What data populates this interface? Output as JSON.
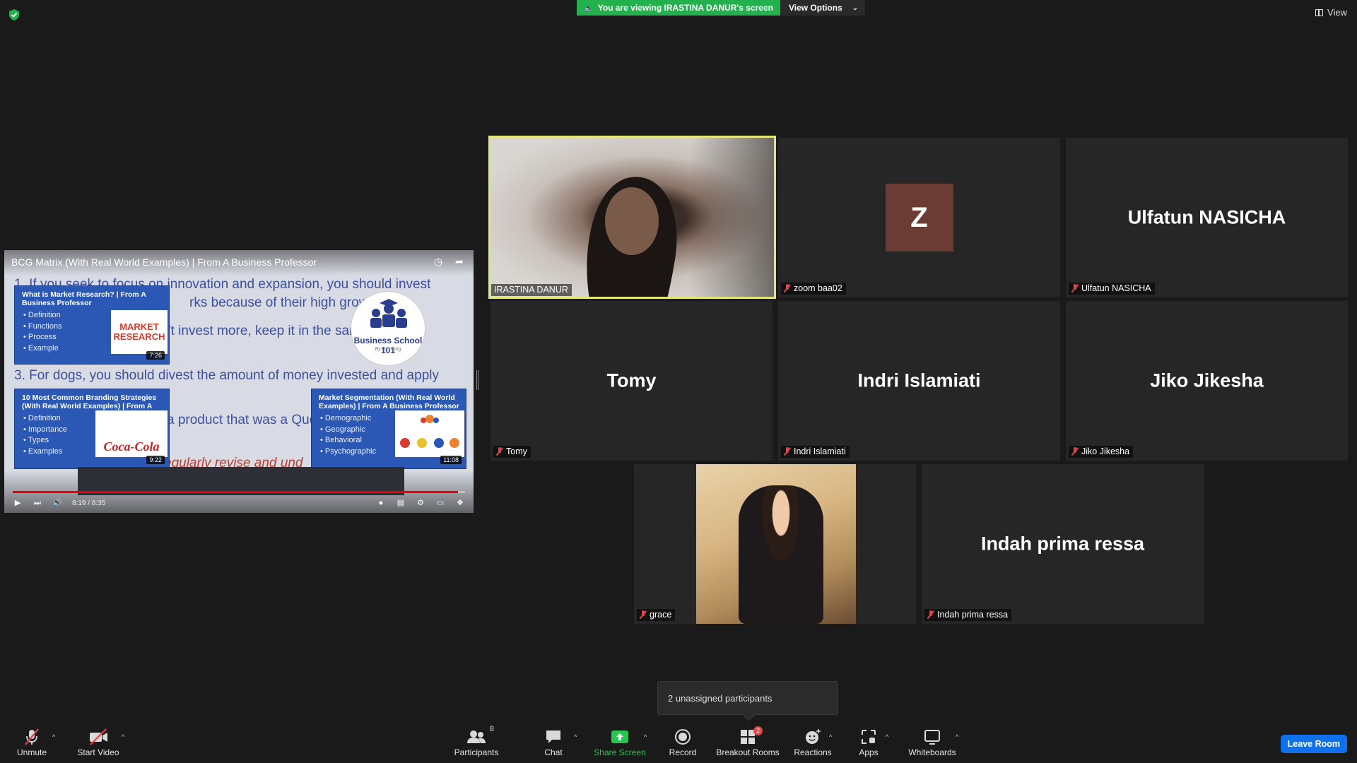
{
  "top_bar": {
    "viewing_text": "You are viewing IRASTINA DANUR's screen",
    "view_options_label": "View Options",
    "view_label": "View",
    "icons": [
      "security-shield-icon",
      "speaker-icon",
      "chevron-down-icon",
      "grid-icon"
    ]
  },
  "shared_screen": {
    "video_title": "BCG Matrix (With Real World Examples) | From A Business Professor",
    "slide_lines": [
      "1. If you seek to focus on innovation and expansion, you should invest",
      "rks because of their high growth",
      "'t invest more, keep it in the san",
      "3. For dogs, you should divest the amount of money invested and apply",
      "a product that was a Que",
      "egularly revise and und"
    ],
    "logo_text": "Business School 101",
    "logo_sub": "By Dr. Yong",
    "cards": [
      {
        "title": "What is Market Research? | From A Business Professor",
        "items": [
          "Definition",
          "Functions",
          "Process",
          "Example"
        ],
        "thumb_text": "MARKET RESEARCH",
        "duration": "7:26"
      },
      {
        "title": "10 Most Common Branding Strategies (With Real World Examples) | From A",
        "items": [
          "Definition",
          "Importance",
          "Types",
          "Examples"
        ],
        "thumb_text": "Coca-Cola",
        "duration": "9:22"
      },
      {
        "title": "Market Segmentation (With Real World Examples) | From A Business Professor",
        "items": [
          "Demographic",
          "Geographic",
          "Behavioral",
          "Psychographic"
        ],
        "duration": "11:08"
      }
    ],
    "time_display": "8:19 / 8:35",
    "progress": 0.984
  },
  "participants_tiles": [
    {
      "name": "IRASTINA DANUR",
      "label": "IRASTINA DANUR",
      "video": true,
      "active_speaker": true,
      "muted": false
    },
    {
      "name": "zoom baa02",
      "label": "zoom baa02",
      "avatar_letter": "Z",
      "muted": true
    },
    {
      "name": "Ulfatun NASICHA",
      "label": "Ulfatun NASICHA",
      "muted": true
    },
    {
      "name": "Tomy",
      "label": "Tomy",
      "muted": true
    },
    {
      "name": "Indri Islamiati",
      "label": "Indri Islamiati",
      "muted": true
    },
    {
      "name": "Jiko Jikesha",
      "label": "Jiko Jikesha",
      "muted": true
    },
    {
      "name": "grace",
      "label": "grace",
      "video": true,
      "muted": true
    },
    {
      "name": "Indah prima ressa",
      "label": "Indah prima ressa",
      "muted": true
    }
  ],
  "unassigned_popup": "2 unassigned participants",
  "toolbar": {
    "unmute": "Unmute",
    "start_video": "Start Video",
    "participants": "Participants",
    "participants_count": "8",
    "chat": "Chat",
    "share_screen": "Share Screen",
    "record": "Record",
    "breakout_rooms": "Breakout Rooms",
    "breakout_badge": "2",
    "reactions": "Reactions",
    "apps": "Apps",
    "whiteboards": "Whiteboards",
    "leave_room": "Leave Room"
  },
  "colors": {
    "background": "#1a1a1a",
    "tile": "#262626",
    "active_speaker_border": "#e2e77a",
    "banner_green": "#22b14c",
    "share_green": "#27c552",
    "leave_blue": "#0e71eb",
    "mute_red": "#e0474c"
  }
}
